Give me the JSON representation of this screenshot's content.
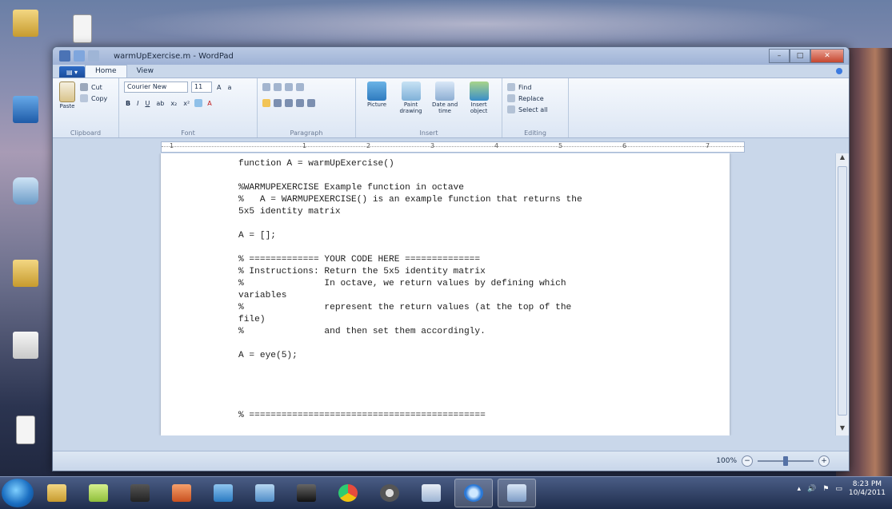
{
  "window": {
    "title": "warmUpExercise.m - WordPad"
  },
  "ribbon": {
    "tabs": [
      "Home",
      "View"
    ],
    "clipboard": {
      "paste": "Paste",
      "cut": "Cut",
      "copy": "Copy",
      "group": "Clipboard"
    },
    "font": {
      "family": "Courier New",
      "size": "11",
      "group": "Font"
    },
    "paragraph": {
      "group": "Paragraph"
    },
    "insert": {
      "picture": "Picture",
      "paint": "Paint drawing",
      "datetime": "Date and time",
      "object": "Insert object",
      "group": "Insert"
    },
    "editing": {
      "find": "Find",
      "replace": "Replace",
      "select_all": "Select all",
      "group": "Editing"
    }
  },
  "ruler": [
    "1",
    "1",
    "2",
    "3",
    "4",
    "5",
    "6",
    "7"
  ],
  "document": {
    "lines": [
      "function A = warmUpExercise()",
      "",
      "%WARMUPEXERCISE Example function in octave",
      "%   A = WARMUPEXERCISE() is an example function that returns the",
      "5x5 identity matrix",
      "",
      "A = [];",
      "",
      "% ============= YOUR CODE HERE ==============",
      "% Instructions: Return the 5x5 identity matrix",
      "%               In octave, we return values by defining which",
      "variables",
      "%               represent the return values (at the top of the",
      "file)",
      "%               and then set them accordingly.",
      "",
      "A = eye(5);",
      "",
      "",
      "",
      "",
      "% ============================================"
    ]
  },
  "status": {
    "zoom": "100%"
  },
  "taskbar": {
    "time": "8:23 PM",
    "date": "10/4/2011"
  },
  "colors": {
    "accent": "#1b4d9b",
    "ribbon_bg": "#dce6f4"
  },
  "icons": [
    "start-orb",
    "explorer-icon",
    "sticky-notes-icon",
    "media-icon",
    "powerpoint-icon",
    "network-icon",
    "remote-icon",
    "terminal-icon",
    "chrome-icon",
    "obs-icon",
    "paint-icon",
    "octave-icon",
    "wordpad-icon"
  ]
}
